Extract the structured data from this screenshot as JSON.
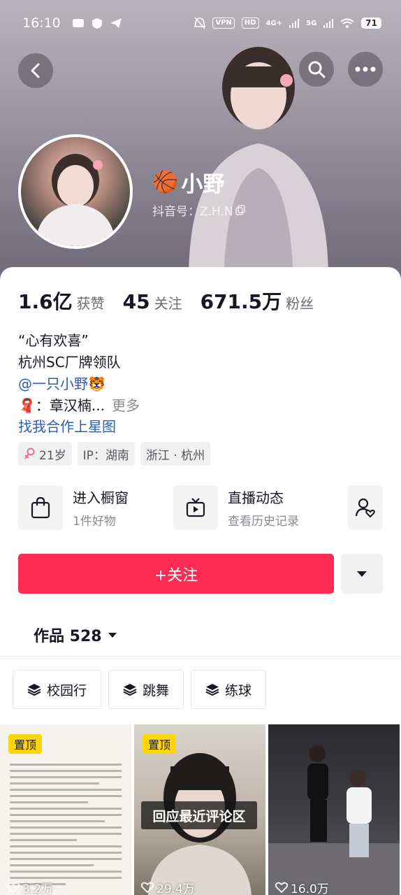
{
  "status_bar": {
    "time": "16:10",
    "vpn": "VPN",
    "hd": "HD",
    "net1": "4G+",
    "net2": "5G",
    "battery": "71"
  },
  "header": {
    "name": "小野",
    "name_emoji": "🏀",
    "douyin_id": "抖音号：Z.H.N"
  },
  "stats": [
    {
      "num": "1.6亿",
      "label": "获赞"
    },
    {
      "num": "45",
      "label": "关注"
    },
    {
      "num": "671.5万",
      "label": "粉丝"
    }
  ],
  "bio": {
    "line1": "“心有欢喜”",
    "line2": "杭州SC厂牌领队",
    "line3": "@一只小野🐯",
    "line4_emoji": "🧣",
    "line4": "：章汉楠...",
    "more": "更多",
    "star_link": "找我合作上星图"
  },
  "tags": [
    {
      "text": "21岁",
      "icon": "female-icon"
    },
    {
      "text": "IP：湖南"
    },
    {
      "text": "浙江 · 杭州"
    }
  ],
  "entries": [
    {
      "title": "进入橱窗",
      "sub": "1件好物",
      "icon": "shopping-bag-icon"
    },
    {
      "title": "直播动态",
      "sub": "查看历史记录",
      "icon": "tv-icon"
    }
  ],
  "actions": {
    "follow_label": "+关注",
    "dropdown": "caret-down-icon"
  },
  "works": {
    "label": "作品 528"
  },
  "chips": [
    {
      "label": "校园行"
    },
    {
      "label": "跳舞"
    },
    {
      "label": "练球"
    }
  ],
  "videos": [
    {
      "pinned": "置顶",
      "likes": "3.2万"
    },
    {
      "pinned": "置顶",
      "likes": "29.4万",
      "caption": "回应最近评论区"
    },
    {
      "likes": "16.0万"
    }
  ],
  "colors": {
    "accent": "#fe2c55",
    "link": "#2b5cb8",
    "pin": "#ffd60a"
  }
}
